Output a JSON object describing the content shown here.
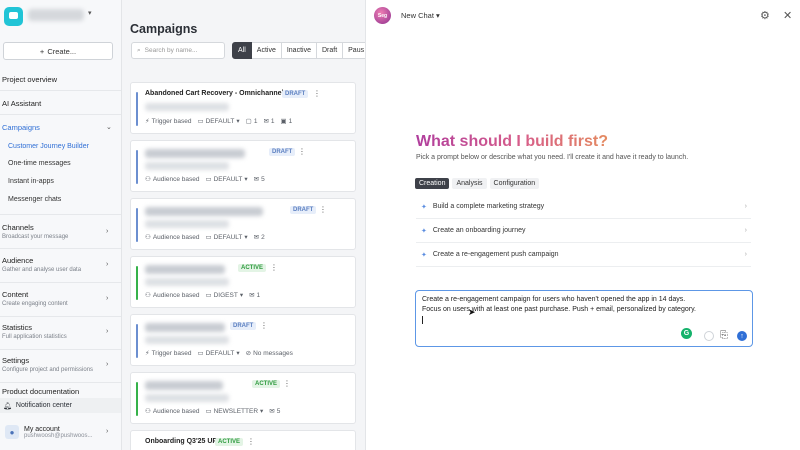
{
  "sidebar": {
    "create_label": "Create...",
    "project_overview": "Project overview",
    "ai_assistant": "AI Assistant",
    "campaigns": {
      "label": "Campaigns",
      "items": [
        "Customer Journey Builder",
        "One-time messages",
        "Instant in-apps",
        "Messenger chats"
      ]
    },
    "sections": [
      {
        "label": "Channels",
        "desc": "Broadcast your message"
      },
      {
        "label": "Audience",
        "desc": "Gather and analyse user data"
      },
      {
        "label": "Content",
        "desc": "Create engaging content"
      },
      {
        "label": "Statistics",
        "desc": "Full application statistics"
      },
      {
        "label": "Settings",
        "desc": "Configure project and permissions"
      }
    ],
    "product_docs": "Product documentation",
    "notification_center": "Notification center",
    "account": {
      "name": "My account",
      "email": "pushwoosh@pushwoos..."
    }
  },
  "campaigns": {
    "title": "Campaigns",
    "search_placeholder": "Search by name...",
    "filters": [
      "All",
      "Active",
      "Inactive",
      "Draft",
      "Paus"
    ],
    "selected_filter": "All",
    "cards": [
      {
        "title": "Abandoned Cart Recovery - Omnichannel",
        "status": "DRAFT",
        "trigger": "Trigger based",
        "folder": "DEFAULT",
        "m1": "1",
        "m2": "1",
        "m3": "1"
      },
      {
        "title": "",
        "status": "DRAFT",
        "trigger": "Audience based",
        "folder": "DEFAULT",
        "m1": "5"
      },
      {
        "title": "",
        "status": "DRAFT",
        "trigger": "Audience based",
        "folder": "DEFAULT",
        "m1": "2"
      },
      {
        "title": "",
        "status": "ACTIVE",
        "trigger": "Audience based",
        "folder": "DIGEST",
        "m1": "1"
      },
      {
        "title": "",
        "status": "DRAFT",
        "trigger": "Trigger based",
        "folder": "DEFAULT",
        "m1": "No messages"
      },
      {
        "title": "",
        "status": "ACTIVE",
        "trigger": "Audience based",
        "folder": "NEWSLETTER",
        "m1": "5"
      },
      {
        "title": "Onboarding Q3'25 UPD",
        "status": "ACTIVE"
      }
    ]
  },
  "chat": {
    "header": "New Chat",
    "headline": "What should I build first?",
    "subline": "Pick a prompt below or describe what you need. I'll create it and have it ready to launch.",
    "tabs": [
      "Creation",
      "Analysis",
      "Configuration"
    ],
    "prompts": [
      "Build a complete marketing strategy",
      "Create an onboarding journey",
      "Create a re-engagement push campaign"
    ],
    "input_line1": "Create a re-engagement campaign for users who haven't opened the app in 14 days.",
    "input_line2": "Focus on users with at least one past purchase. Push + email, personalized by category."
  }
}
